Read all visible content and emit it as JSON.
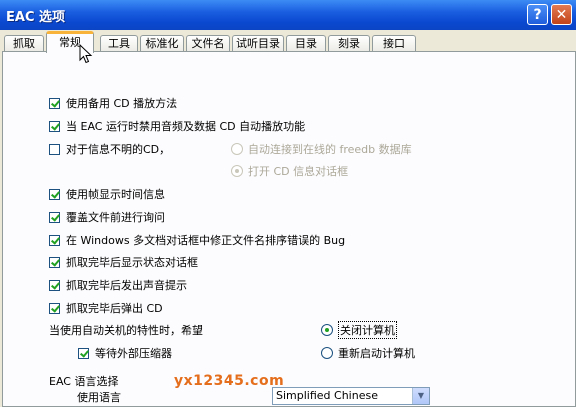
{
  "window": {
    "title": "EAC 选项",
    "help_label": "?",
    "close_label": "✕"
  },
  "tabs": [
    {
      "label": "抓取"
    },
    {
      "label": "常规"
    },
    {
      "label": "工具"
    },
    {
      "label": "标准化"
    },
    {
      "label": "文件名"
    },
    {
      "label": "试听目录"
    },
    {
      "label": "目录"
    },
    {
      "label": "刻录"
    },
    {
      "label": "接口"
    }
  ],
  "general": {
    "use_alt_playback": "使用备用 CD 播放方法",
    "disable_autoplay": "当 EAC 运行时禁用音频及数据 CD 自动播放功能",
    "unknown_cd": "对于信息不明的CD，",
    "auto_freedb": "自动连接到在线的 freedb 数据库",
    "open_cd_dialog": "打开 CD 信息对话框",
    "use_frames": "使用帧显示时间信息",
    "ask_overwrite": "覆盖文件前进行询问",
    "fix_sort_bug": "在 Windows 多文档对话框中修正文件名排序错误的 Bug",
    "show_status": "抓取完毕后显示状态对话框",
    "play_sound": "抓取完毕后发出声音提示",
    "eject_cd": "抓取完毕后弹出 CD",
    "auto_shutdown_label": "当使用自动关机的特性时，希望",
    "wait_compressor": "等待外部压缩器",
    "shutdown_pc": "关闭计算机",
    "restart_pc": "重新启动计算机",
    "lang_section": "EAC 语言选择",
    "use_language": "使用语言",
    "language_value": "Simplified Chinese"
  },
  "watermark": "yx12345.com",
  "colors": {
    "titlebar": "#0a48d0",
    "active_tab_accent": "#f8b33a",
    "check": "#21a121"
  }
}
